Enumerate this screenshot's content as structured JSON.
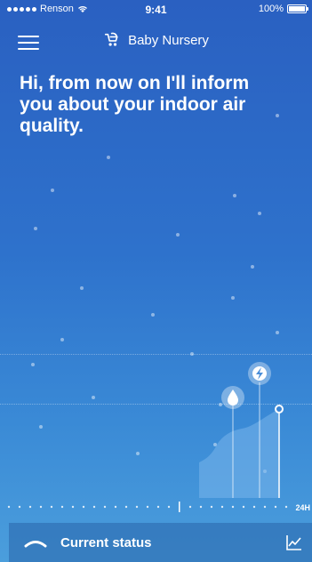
{
  "status_bar": {
    "carrier": "Renson",
    "time": "9:41",
    "battery": "100%"
  },
  "header": {
    "title": "Baby Nursery",
    "menu_icon": "hamburger-icon",
    "room_icon": "stroller-icon"
  },
  "message": {
    "headline": "Hi, from now on I'll inform you about your indoor air quality."
  },
  "chart": {
    "markers": [
      {
        "icon": "humidity-drop-icon"
      },
      {
        "icon": "lightning-icon"
      }
    ],
    "axis_end_label": "24H"
  },
  "bottom_bar": {
    "label": "Current status",
    "expand_icon": "chevron-up-icon",
    "history_icon": "line-graph-icon"
  },
  "colors": {
    "background_top": "#2a60c1",
    "background_bottom": "#4b9edc",
    "text": "#ffffff"
  }
}
